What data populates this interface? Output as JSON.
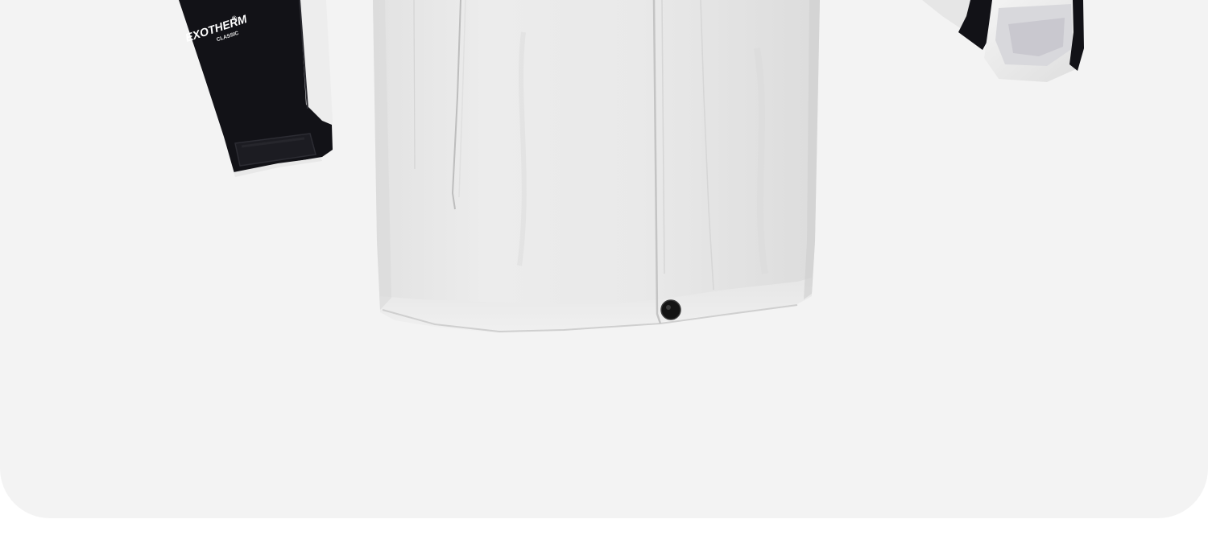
{
  "product_image": {
    "logo": {
      "brand": "EXOTHERM",
      "registered_mark": "®",
      "line": "CLASSIC"
    },
    "colors": {
      "background": "#f3f3f3",
      "jacket_body": "#e8e8e8",
      "sleeve_dark": "#121217",
      "snap_button": "#141414"
    }
  }
}
